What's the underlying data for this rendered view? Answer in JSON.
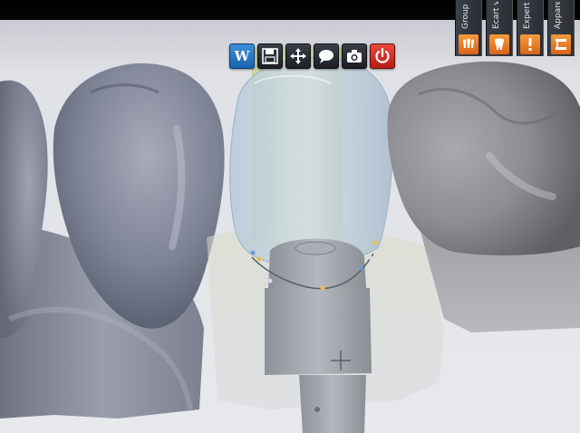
{
  "toolbar": {
    "buttons": [
      {
        "name": "wizard-button",
        "icon": "wizard-w-icon",
        "glyph": "W",
        "color": "#2474c4"
      },
      {
        "name": "save-button",
        "icon": "floppy-disk-icon",
        "color": "#23272f"
      },
      {
        "name": "move-button",
        "icon": "move-arrows-icon",
        "color": "#23272f"
      },
      {
        "name": "comment-button",
        "icon": "speech-bubble-icon",
        "color": "#23272f"
      },
      {
        "name": "screenshot-button",
        "icon": "camera-icon",
        "color": "#23272f"
      },
      {
        "name": "exit-button",
        "icon": "power-icon",
        "color": "#c9261a"
      }
    ]
  },
  "side_panel": {
    "tabs": [
      {
        "label": "Group",
        "icon": "group-teeth-icon"
      },
      {
        "label": "Écart v",
        "icon": "tooth-icon"
      },
      {
        "label": "Expert",
        "icon": "expert-warning-icon"
      },
      {
        "label": "Appare",
        "icon": "articulator-icon"
      }
    ],
    "accent": "#e9802a"
  },
  "viewport": {
    "background": "#e3e4e8",
    "objects": [
      "left-teeth-model",
      "abutment-core",
      "transparent-crown",
      "right-tooth-model",
      "margin-line-markers",
      "crosshair-cursor"
    ]
  }
}
